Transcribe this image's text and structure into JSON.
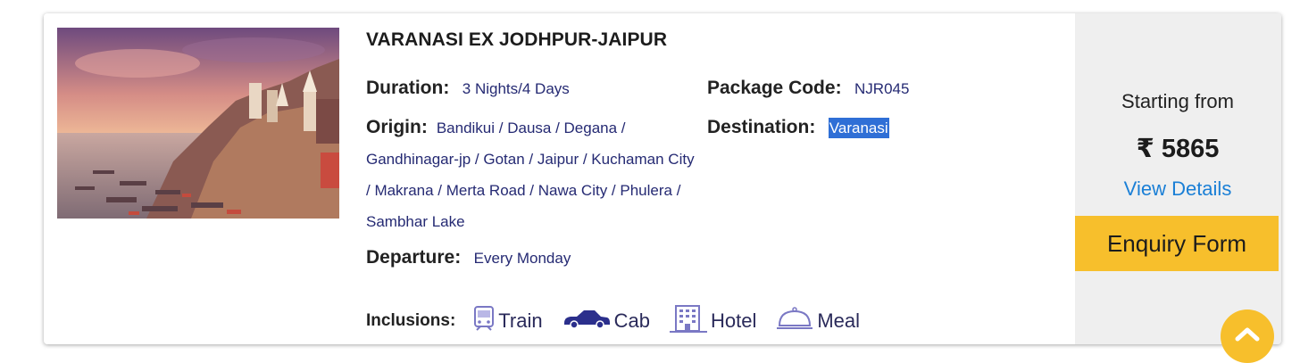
{
  "package": {
    "title": "VARANASI EX JODHPUR-JAIPUR",
    "duration_label": "Duration:",
    "duration_value": "3 Nights/4 Days",
    "code_label": "Package Code:",
    "code_value": "NJR045",
    "origin_label": "Origin:",
    "origin_value": "Bandikui / Dausa / Degana / Gandhinagar-jp / Gotan / Jaipur / Kuchaman City / Makrana / Merta Road / Nawa City / Phulera / Sambhar Lake",
    "destination_label": "Destination:",
    "destination_value": "Varanasi",
    "departure_label": "Departure:",
    "departure_value": "Every Monday",
    "inclusions_label": "Inclusions:",
    "inclusions": [
      {
        "label": "Train",
        "icon": "train-icon"
      },
      {
        "label": "Cab",
        "icon": "cab-icon"
      },
      {
        "label": "Hotel",
        "icon": "hotel-icon"
      },
      {
        "label": "Meal",
        "icon": "meal-icon"
      }
    ]
  },
  "pricing": {
    "starting_label": "Starting from",
    "price": "₹ 5865",
    "details_link": "View Details",
    "enquiry_button": "Enquiry Form"
  },
  "colors": {
    "accent": "#f7bf2c",
    "link": "#1a7fd6",
    "value_text": "#252a73",
    "highlight": "#2f6fd6",
    "sidebar_bg": "#efefef"
  },
  "icons": {
    "scroll_top": "chevron-up-icon"
  }
}
